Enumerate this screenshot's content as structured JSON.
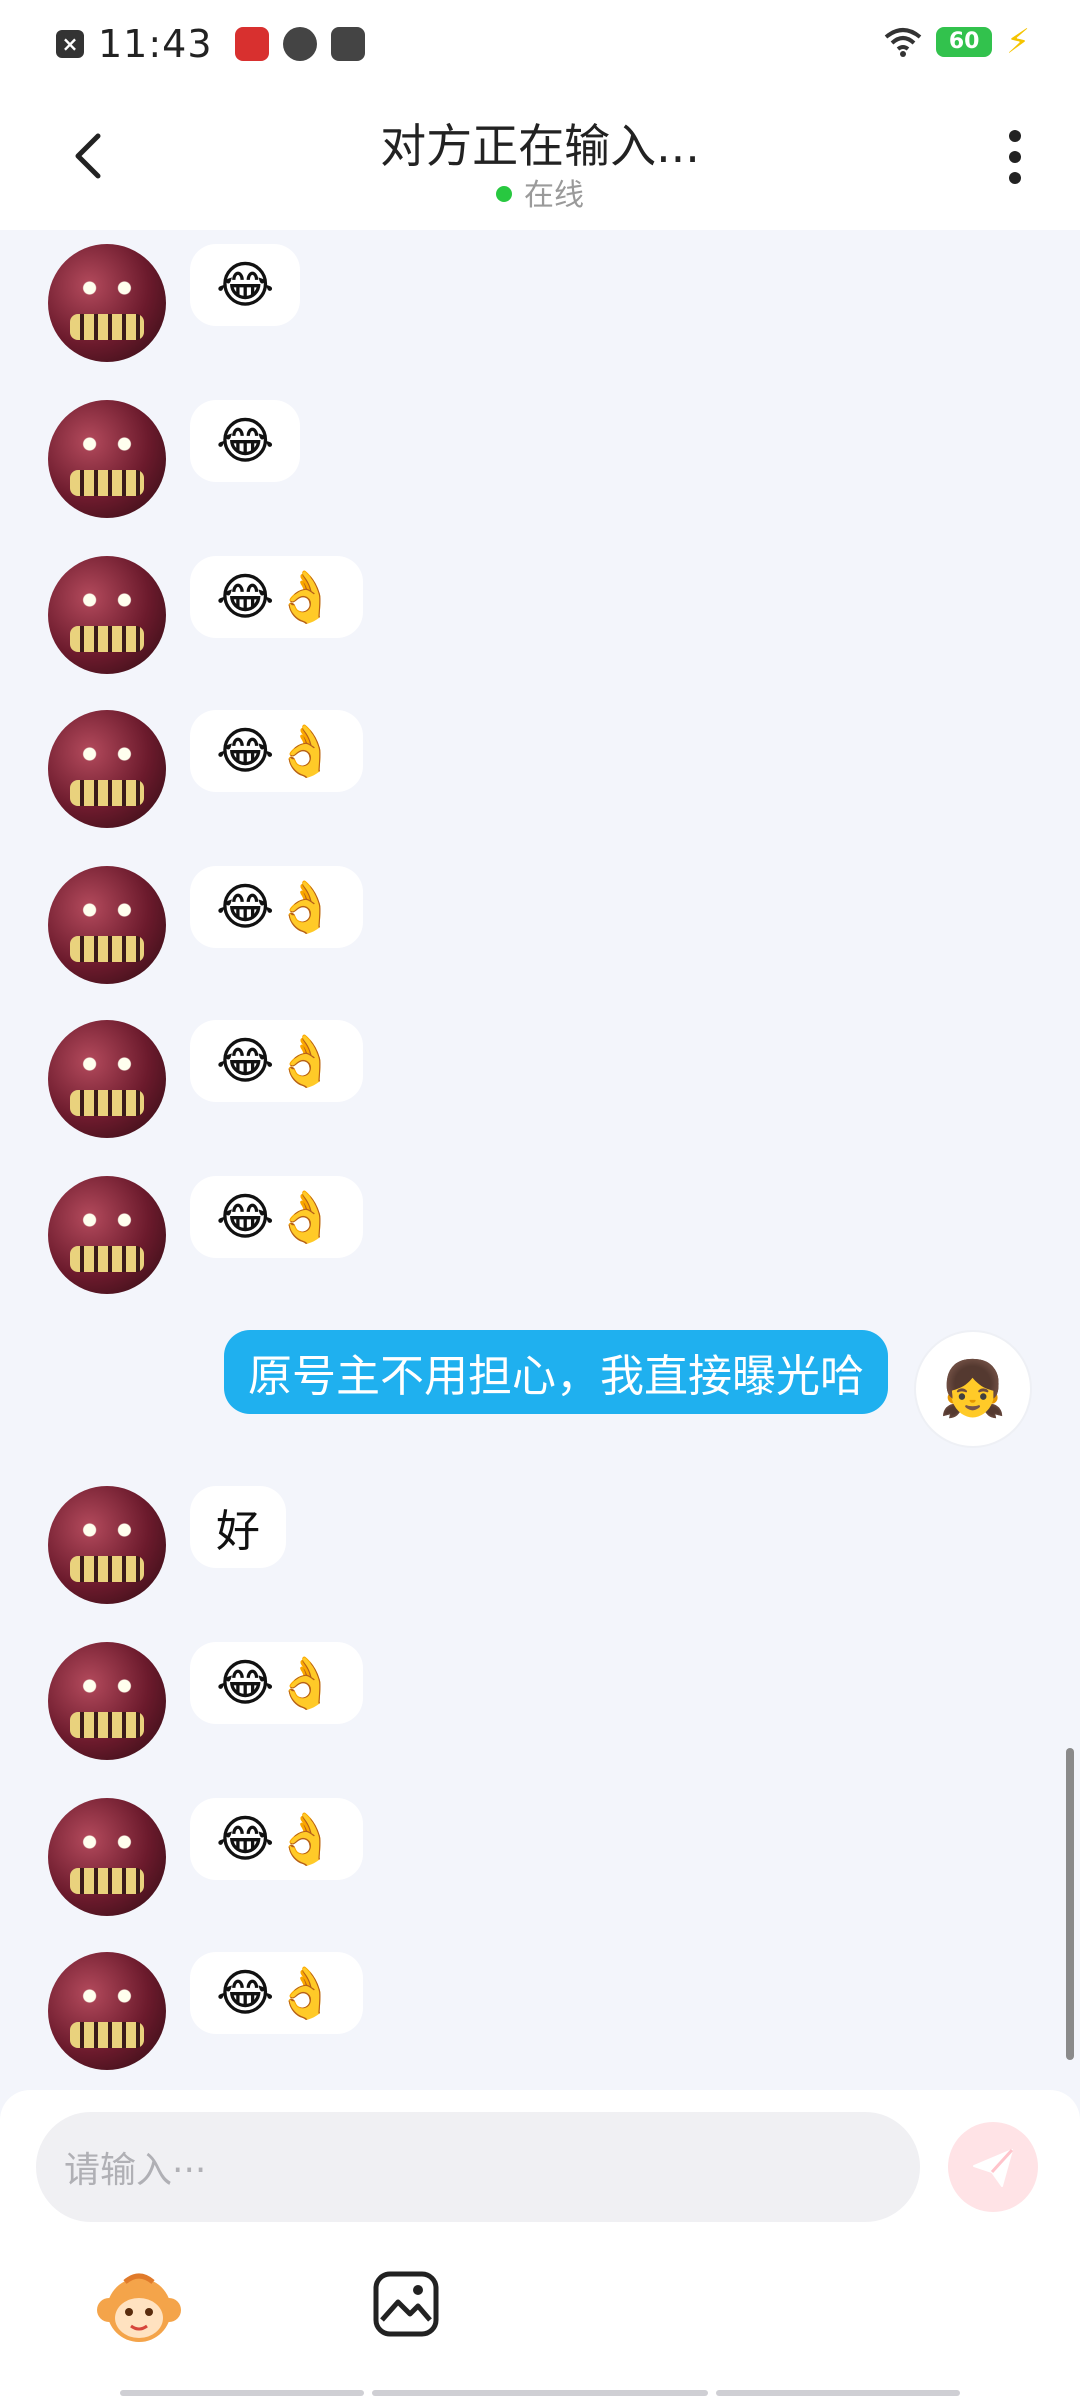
{
  "status_bar": {
    "time": "11:43",
    "battery": "60",
    "icons": [
      "close-notification-icon",
      "app-icon-red",
      "feather-app-icon",
      "play-app-icon",
      "wifi-icon",
      "battery-icon",
      "charging-bolt-icon"
    ]
  },
  "header": {
    "title": "对方正在输入...",
    "status": "在线"
  },
  "messages": [
    {
      "side": "received",
      "content": "😂"
    },
    {
      "side": "received",
      "content": "😂"
    },
    {
      "side": "received",
      "content": "😂👌"
    },
    {
      "side": "received",
      "content": "😂👌"
    },
    {
      "side": "received",
      "content": "😂👌"
    },
    {
      "side": "received",
      "content": "😂👌"
    },
    {
      "side": "received",
      "content": "😂👌"
    },
    {
      "side": "sent",
      "content": "原号主不用担心，我直接曝光哈"
    },
    {
      "side": "received",
      "content": "好"
    },
    {
      "side": "received",
      "content": "😂👌"
    },
    {
      "side": "received",
      "content": "😂👌"
    },
    {
      "side": "received",
      "content": "😂👌"
    }
  ],
  "input": {
    "placeholder": "请输入···"
  },
  "colors": {
    "sent_bubble": "#1fb0ef",
    "online_dot": "#28c840",
    "send_button": "#ffe3e6",
    "background": "#f3f5fb"
  }
}
